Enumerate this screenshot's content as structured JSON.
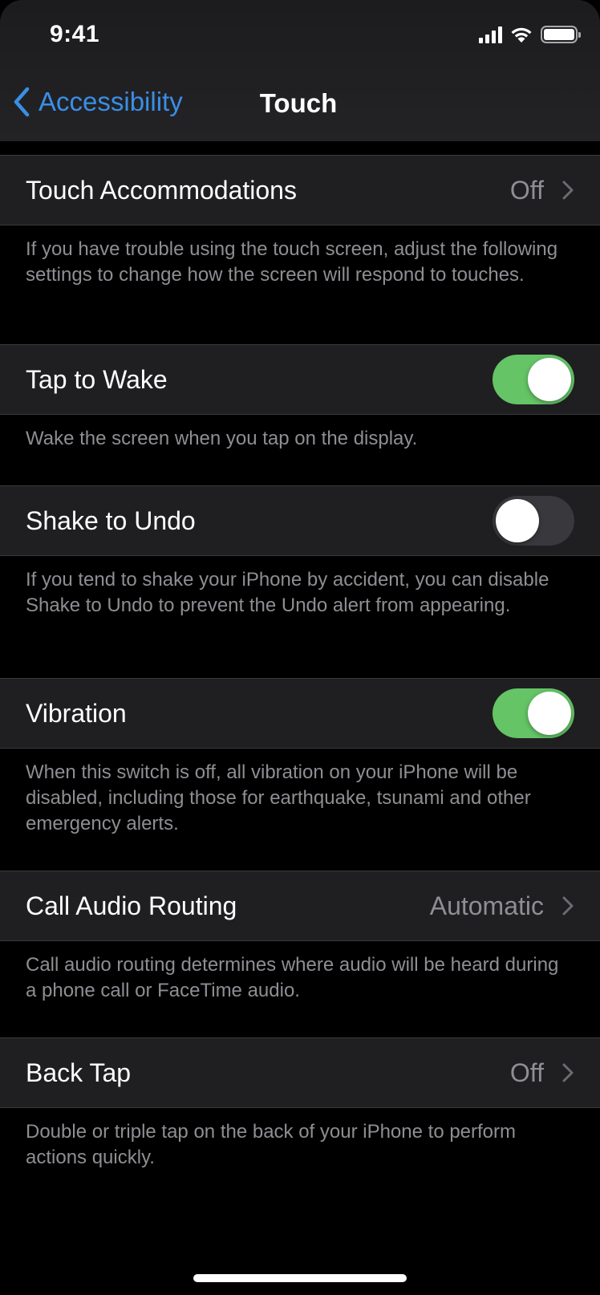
{
  "status_bar": {
    "time": "9:41",
    "icons": [
      "cellular-signal-icon",
      "wifi-icon",
      "battery-icon"
    ]
  },
  "nav": {
    "back_label": "Accessibility",
    "title": "Touch"
  },
  "colors": {
    "accent": "#3a8ee6",
    "switch_on": "#65c466",
    "switch_off": "#39393d",
    "cell_bg": "#1f1f21",
    "secondary_text": "#8e8e93"
  },
  "sections": [
    {
      "label": "Touch Accommodations",
      "type": "disclosure",
      "value": "Off",
      "footer": "If you have trouble using the touch screen, adjust the following settings to change how the screen will respond to touches."
    },
    {
      "label": "Tap to Wake",
      "type": "toggle",
      "on": true,
      "footer": "Wake the screen when you tap on the display."
    },
    {
      "label": "Shake to Undo",
      "type": "toggle",
      "on": false,
      "footer": "If you tend to shake your iPhone by accident, you can disable Shake to Undo to prevent the Undo alert from appearing."
    },
    {
      "label": "Vibration",
      "type": "toggle",
      "on": true,
      "footer": "When this switch is off, all vibration on your iPhone will be disabled, including those for earthquake, tsunami and other emergency alerts."
    },
    {
      "label": "Call Audio Routing",
      "type": "disclosure",
      "value": "Automatic",
      "footer": "Call audio routing determines where audio will be heard during a phone call or FaceTime audio."
    },
    {
      "label": "Back Tap",
      "type": "disclosure",
      "value": "Off",
      "footer": "Double or triple tap on the back of your iPhone to perform actions quickly."
    }
  ]
}
